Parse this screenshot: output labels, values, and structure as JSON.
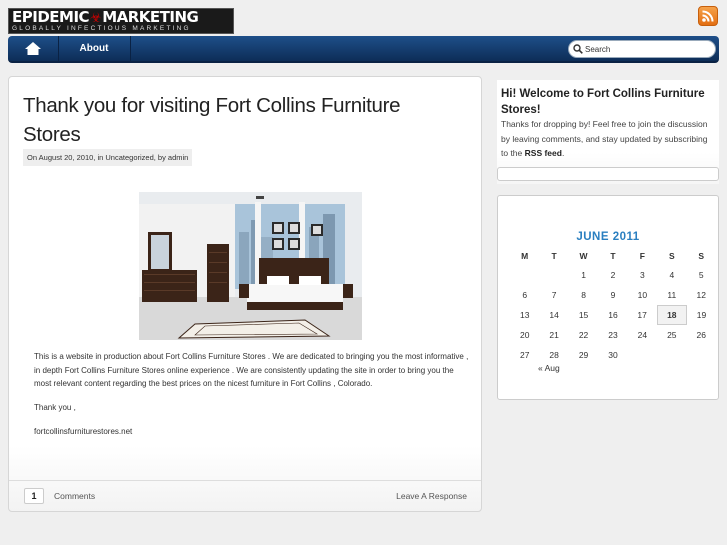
{
  "header": {
    "logo": {
      "text_left": "EPIDEMIC",
      "text_right": "MARKETING",
      "tagline": "GLOBALLY INFECTIOUS MARKETING"
    },
    "rss_icon": "rss-icon"
  },
  "nav": {
    "home_icon": "home-icon",
    "about_label": "About",
    "search_placeholder": "Search"
  },
  "post": {
    "title": "Thank you for visiting Fort Collins Furniture Stores",
    "meta": "On August 20, 2010, in Uncategorized, by admin",
    "body": [
      "This is a website in production about Fort Collins Furniture Stores . We are dedicated to bringing you the most informative , in depth Fort Collins Furniture Stores online experience . We are consistently updating the site in order to bring you the most relevant content regarding the best prices on the nicest furniture in Fort Collins , Colorado.",
      "Thank you ,",
      "fortcollinsfurniturestores.net"
    ],
    "comment_count": "1",
    "comments_label": "Comments",
    "leave_response_label": "Leave A Response"
  },
  "sidebar": {
    "welcome_title": "Hi! Welcome to Fort Collins Furniture Stores!",
    "welcome_text_before": "Thanks for dropping by! Feel free to join the discussion by leaving comments, and stay updated by subscribing to the ",
    "welcome_text_link": "RSS feed",
    "welcome_text_after": ".",
    "calendar": {
      "caption": "JUNE 2011",
      "weekdays": [
        "M",
        "T",
        "W",
        "T",
        "F",
        "S",
        "S"
      ],
      "weeks": [
        [
          "",
          "",
          "1",
          "2",
          "3",
          "4",
          "5"
        ],
        [
          "6",
          "7",
          "8",
          "9",
          "10",
          "11",
          "12"
        ],
        [
          "13",
          "14",
          "15",
          "16",
          "17",
          "18",
          "19"
        ],
        [
          "20",
          "21",
          "22",
          "23",
          "24",
          "25",
          "26"
        ],
        [
          "27",
          "28",
          "29",
          "30",
          "",
          "",
          ""
        ]
      ],
      "today": "18",
      "prev_link": "« Aug"
    }
  }
}
